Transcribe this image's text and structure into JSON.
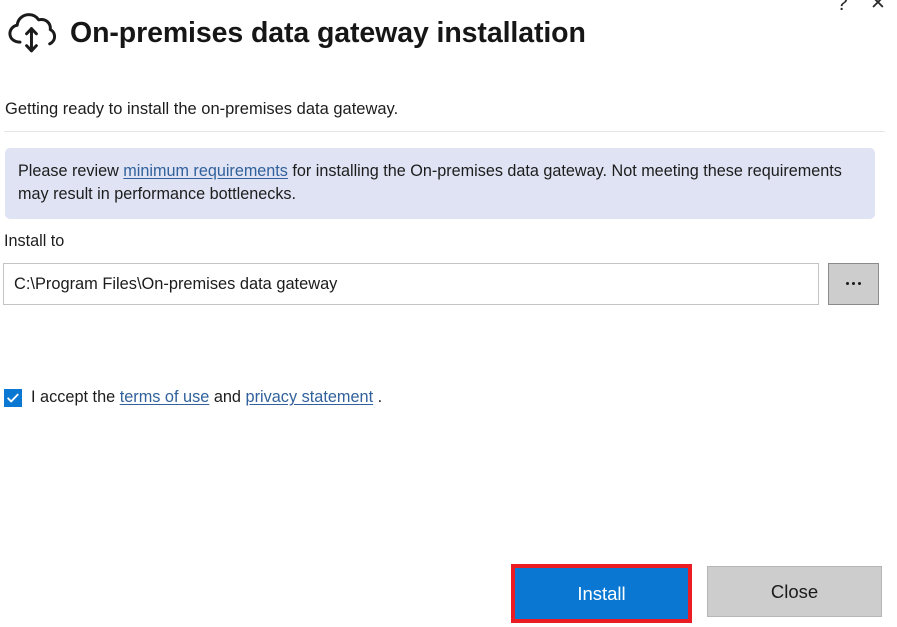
{
  "window": {
    "help_icon": "question-mark-icon",
    "close_icon": "close-x-icon",
    "help_glyph": "?",
    "close_glyph": "✕"
  },
  "header": {
    "icon": "cloud-upload-download-icon",
    "title": "On-premises data gateway installation"
  },
  "subtitle": "Getting ready to install the on-premises data gateway.",
  "banner": {
    "text_before_link": "Please review ",
    "link_label": "minimum requirements",
    "text_after_link": " for installing the On-premises data gateway. Not meeting these requirements may result in performance bottlenecks.",
    "background_color": "#dfe3f3",
    "link_color": "#31619c"
  },
  "install_to": {
    "label": "Install to",
    "path_value": "C:\\Program Files\\On-premises data gateway",
    "path_placeholder": "C:\\Program Files\\On-premises data gateway",
    "browse_button_label": "...",
    "browse_icon": "ellipsis-icon"
  },
  "accept": {
    "checked": true,
    "checkbox_color": "#0a78d2",
    "text_before": "I accept the ",
    "terms_link": "terms of use",
    "text_middle": " and ",
    "privacy_link": "privacy statement",
    "text_after": " ."
  },
  "footer": {
    "install_label": "Install",
    "close_label": "Close",
    "install_color": "#0a78d2",
    "close_color": "#cdcdcd",
    "highlight_color": "#ec1c24"
  }
}
